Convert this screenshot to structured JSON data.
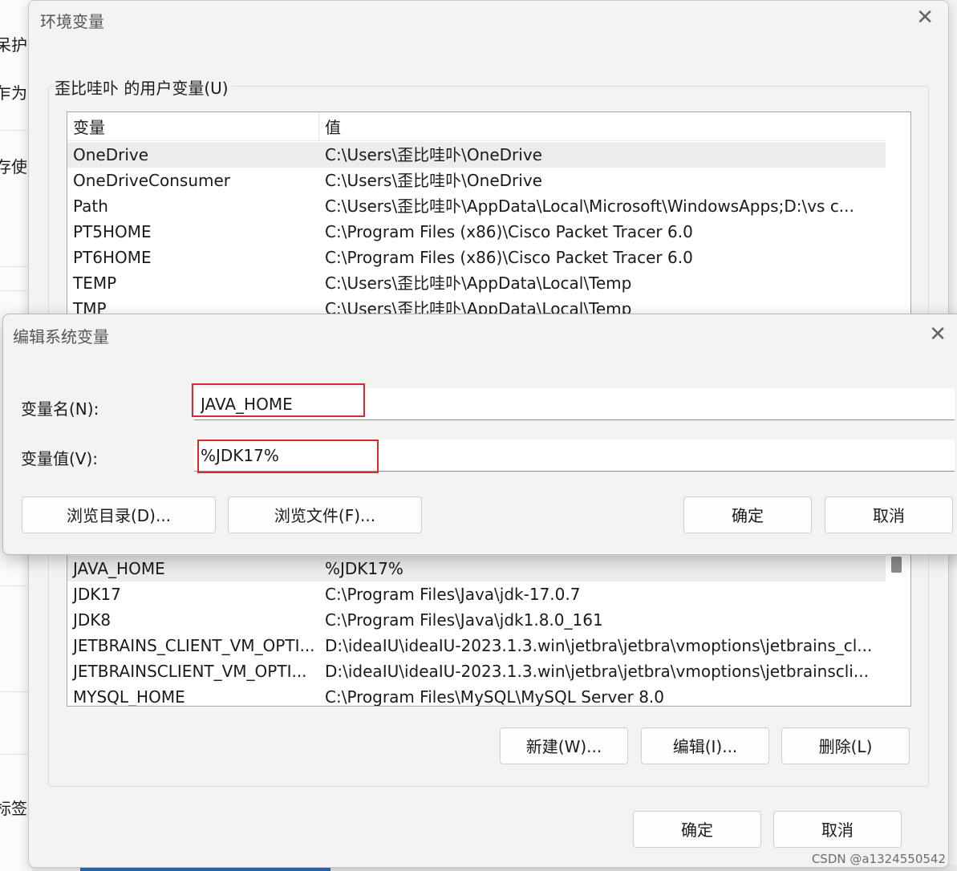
{
  "background_window": {
    "fragments": [
      "呆护",
      "乍为管",
      "存使",
      "标签"
    ]
  },
  "env_window": {
    "title": "环境变量",
    "user_section_label": "歪比哇卟 的用户变量(U)",
    "columns": [
      "变量",
      "值"
    ],
    "user_vars": [
      {
        "name": "OneDrive",
        "value": "C:\\Users\\歪比哇卟\\OneDrive"
      },
      {
        "name": "OneDriveConsumer",
        "value": "C:\\Users\\歪比哇卟\\OneDrive"
      },
      {
        "name": "Path",
        "value": "C:\\Users\\歪比哇卟\\AppData\\Local\\Microsoft\\WindowsApps;D:\\vs c..."
      },
      {
        "name": "PT5HOME",
        "value": "C:\\Program Files (x86)\\Cisco Packet Tracer 6.0"
      },
      {
        "name": "PT6HOME",
        "value": "C:\\Program Files (x86)\\Cisco Packet Tracer 6.0"
      },
      {
        "name": "TEMP",
        "value": "C:\\Users\\歪比哇卟\\AppData\\Local\\Temp"
      },
      {
        "name": "TMP",
        "value": "C:\\Users\\歪比哇卟\\AppData\\Local\\Temp"
      }
    ],
    "system_vars": [
      {
        "name": "JAVA_HOME",
        "value": "%JDK17%"
      },
      {
        "name": "JDK17",
        "value": "C:\\Program Files\\Java\\jdk-17.0.7"
      },
      {
        "name": "JDK8",
        "value": "C:\\Program Files\\Java\\jdk1.8.0_161"
      },
      {
        "name": "JETBRAINS_CLIENT_VM_OPTI...",
        "value": "D:\\ideaIU\\ideaIU-2023.1.3.win\\jetbra\\jetbra\\vmoptions\\jetbrains_cl..."
      },
      {
        "name": "JETBRAINSCLIENT_VM_OPTI...",
        "value": "D:\\ideaIU\\ideaIU-2023.1.3.win\\jetbra\\jetbra\\vmoptions\\jetbrainscli..."
      },
      {
        "name": "MYSQL_HOME",
        "value": "C:\\Program Files\\MySQL\\MySQL Server 8.0"
      }
    ],
    "buttons": {
      "new": "新建(W)...",
      "edit": "编辑(I)...",
      "delete": "删除(L)",
      "ok": "确定",
      "cancel": "取消"
    },
    "close_glyph": "✕"
  },
  "edit_dialog": {
    "title": "编辑系统变量",
    "name_label": "变量名(N):",
    "name_value": "JAVA_HOME",
    "value_label": "变量值(V):",
    "value_value": "%JDK17%",
    "buttons": {
      "browse_dir": "浏览目录(D)...",
      "browse_file": "浏览文件(F)...",
      "ok": "确定",
      "cancel": "取消"
    },
    "close_glyph": "✕",
    "highlight_color": "#e0272e"
  },
  "watermark": "CSDN @a1324550542"
}
